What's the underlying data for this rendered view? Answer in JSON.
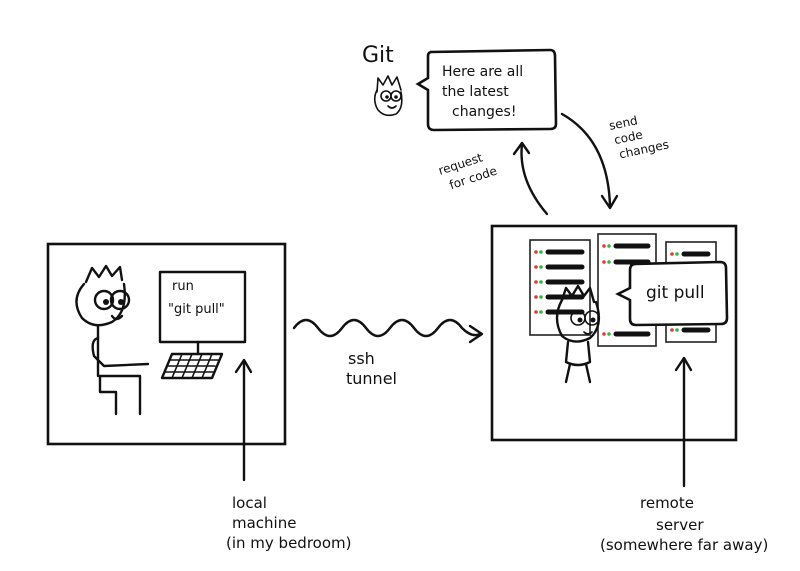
{
  "git_label": "Git",
  "git_speech": [
    "Here are all",
    "the latest",
    "changes!"
  ],
  "request_label": [
    "request",
    "for code"
  ],
  "send_label": [
    "send",
    "code",
    "changes"
  ],
  "monitor_text": [
    "run",
    "\"git pull\""
  ],
  "ssh_label": [
    "ssh",
    "tunnel"
  ],
  "server_speech": "git pull",
  "local_label": [
    "local",
    "machine",
    "(in my bedroom)"
  ],
  "remote_label": [
    "remote",
    "server",
    "(somewhere far away)"
  ],
  "colors": {
    "ink": "#111111",
    "led_red": "#e03b2d",
    "led_green": "#3cb043"
  }
}
